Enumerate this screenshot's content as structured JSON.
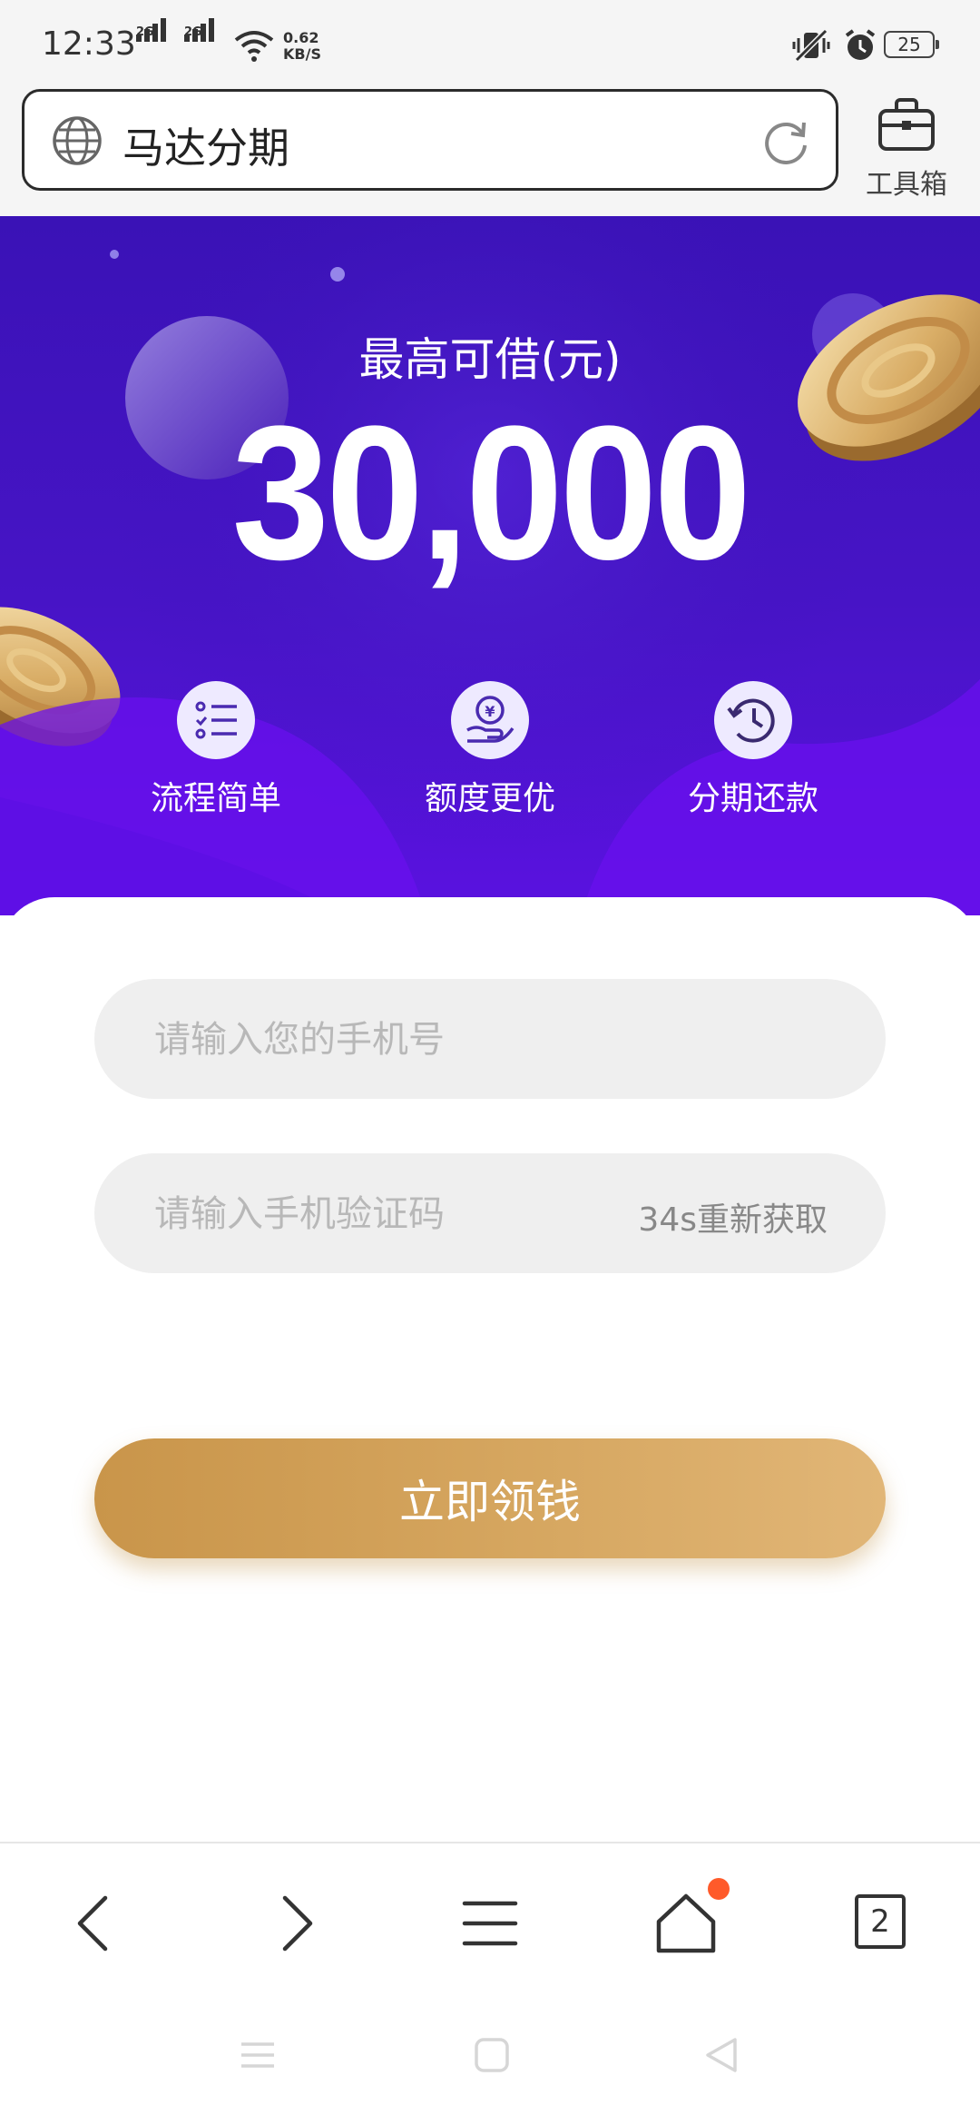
{
  "status_bar": {
    "time": "12:33",
    "signal1_label": "2G",
    "signal2_label": "2G",
    "net_speed_value": "0.62",
    "net_speed_unit": "KB/S",
    "battery": "25"
  },
  "address_bar": {
    "url_text": "马达分期",
    "toolbox_label": "工具箱"
  },
  "hero": {
    "title": "最高可借(元)",
    "amount": "30,000",
    "features": [
      {
        "label": "流程简单",
        "icon": "list-check-icon"
      },
      {
        "label": "额度更优",
        "icon": "hand-yen-icon"
      },
      {
        "label": "分期还款",
        "icon": "history-clock-icon"
      }
    ],
    "colors": {
      "bg_top": "#3a12b6",
      "bg_bottom": "#5a12e0"
    }
  },
  "form": {
    "phone_placeholder": "请输入您的手机号",
    "code_placeholder": "请输入手机验证码",
    "resend_label": "34s重新获取",
    "submit_label": "立即领钱",
    "accent": "#d7a862"
  },
  "browser_nav": {
    "tab_count": "2",
    "home_badge_color": "#ff5a2a"
  }
}
